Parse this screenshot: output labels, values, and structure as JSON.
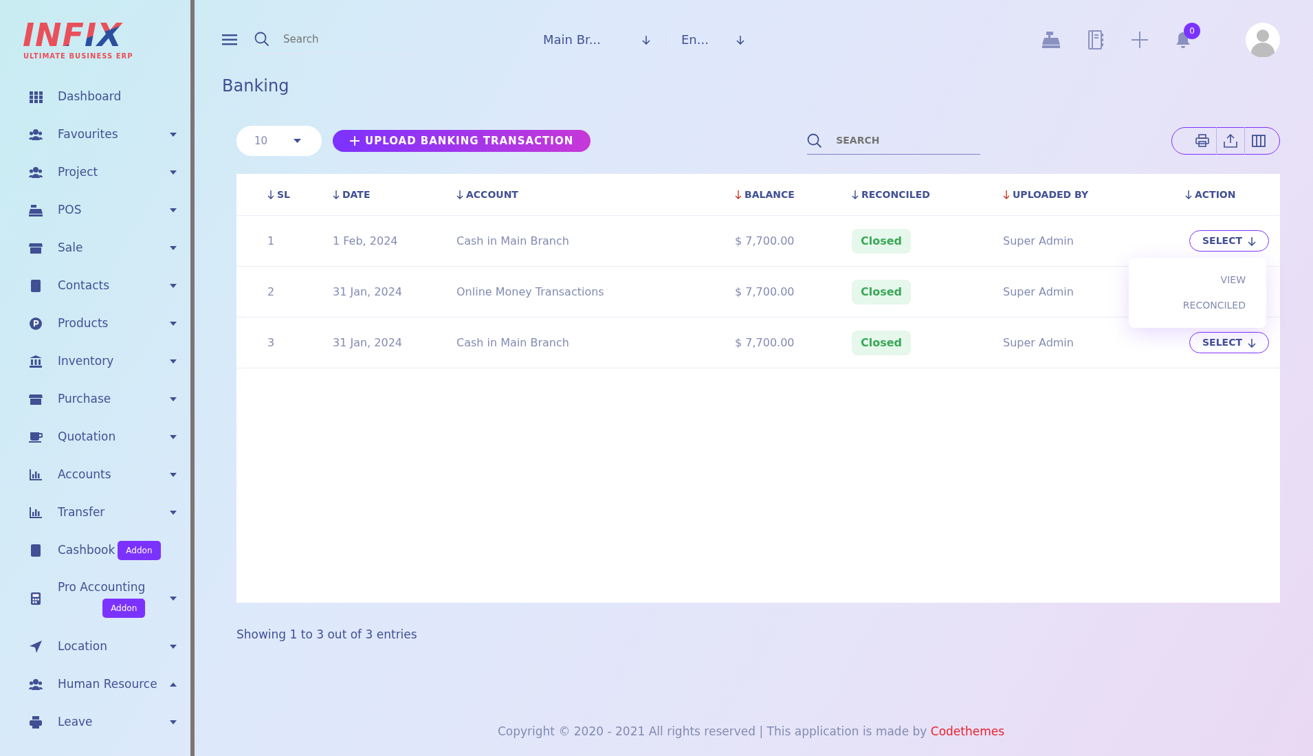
{
  "logo": {
    "name": "INFIX",
    "tagline": "ULTIMATE BUSINESS ERP"
  },
  "sidebar": {
    "items": [
      {
        "kind": "link",
        "label": "Dashboard"
      },
      {
        "kind": "menu",
        "label": "Favourites",
        "expanded": false
      },
      {
        "kind": "menu",
        "label": "Project",
        "expanded": false
      },
      {
        "kind": "menu",
        "label": "POS",
        "expanded": false
      },
      {
        "kind": "menu",
        "label": "Sale",
        "expanded": false
      },
      {
        "kind": "menu",
        "label": "Contacts",
        "expanded": false
      },
      {
        "kind": "menu",
        "label": "Products",
        "expanded": false
      },
      {
        "kind": "menu",
        "label": "Inventory",
        "expanded": false
      },
      {
        "kind": "menu",
        "label": "Purchase",
        "expanded": false
      },
      {
        "kind": "menu",
        "label": "Quotation",
        "expanded": false
      },
      {
        "kind": "menu",
        "label": "Accounts",
        "expanded": false
      },
      {
        "kind": "menu",
        "label": "Transfer",
        "expanded": false
      },
      {
        "kind": "link",
        "label": "Cashbook",
        "badge": "Addon"
      },
      {
        "kind": "menu",
        "label": "Pro Accounting",
        "expanded": false,
        "badge": "Addon"
      },
      {
        "kind": "menu",
        "label": "Location",
        "expanded": false
      },
      {
        "kind": "menu",
        "label": "Human Resource",
        "expanded": true
      },
      {
        "kind": "menu",
        "label": "Leave",
        "expanded": false
      }
    ]
  },
  "header": {
    "search": {
      "placeholder": "Search"
    },
    "branch": "Main Br...",
    "language": "En...",
    "notification_count": "0"
  },
  "page_title": "Banking",
  "toolbar": {
    "page_size": "10",
    "upload_button": "UPLOAD BANKING TRANSACTION",
    "search": {
      "placeholder": "SEARCH"
    }
  },
  "table": {
    "columns": [
      {
        "label": "SL",
        "color": "#3c4a8c"
      },
      {
        "label": "DATE",
        "color": "#3c4a8c"
      },
      {
        "label": "ACCOUNT",
        "color": "#3c4a8c"
      },
      {
        "label": "BALANCE",
        "color": "#c0392b"
      },
      {
        "label": "RECONCILED",
        "color": "#3c4a8c"
      },
      {
        "label": "UPLOADED BY",
        "color": "#c0392b"
      },
      {
        "label": "ACTION",
        "color": "#3c4a8c"
      }
    ],
    "rows": [
      {
        "sl": "1",
        "date": "1 Feb, 2024",
        "account": "Cash in Main Branch",
        "balance": "$ 7,700.00",
        "reconciled": "Closed",
        "uploaded_by": "Super Admin",
        "action": "SELECT",
        "menu_items": [
          "VIEW",
          "RECONCILED"
        ]
      },
      {
        "sl": "2",
        "date": "31 Jan, 2024",
        "account": "Online Money Transactions",
        "balance": "$ 7,700.00",
        "reconciled": "Closed",
        "uploaded_by": "Super Admin"
      },
      {
        "sl": "3",
        "date": "31 Jan, 2024",
        "account": "Cash in Main Branch",
        "balance": "$ 7,700.00",
        "reconciled": "Closed",
        "uploaded_by": "Super Admin",
        "action": "SELECT"
      }
    ]
  },
  "entries_info": "Showing 1 to 3 out of 3 entries",
  "footer": {
    "text": "Copyright © 2020 - 2021 All rights reserved | This application is made by",
    "link": "Codethemes"
  }
}
